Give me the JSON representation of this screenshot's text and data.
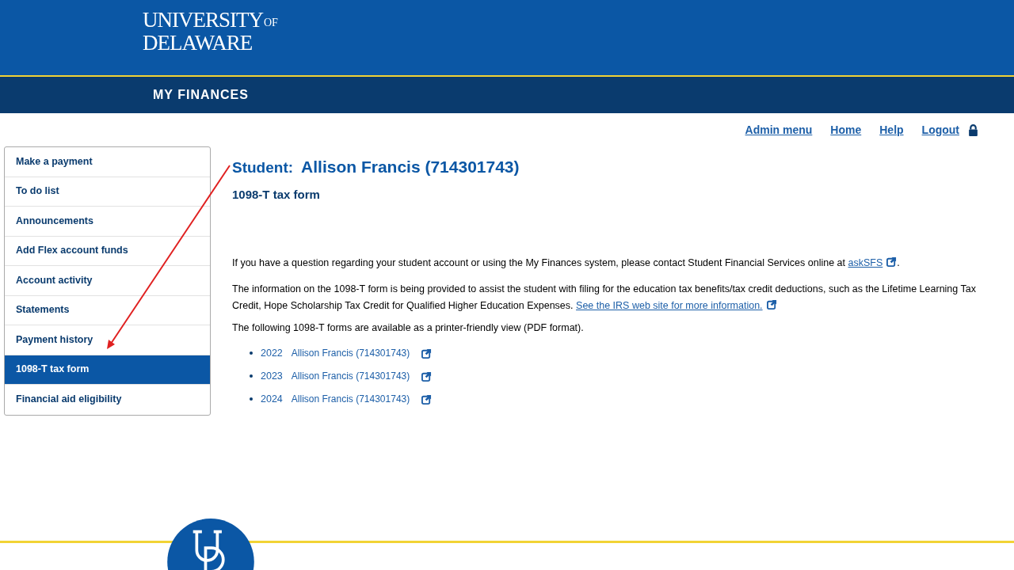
{
  "header": {
    "logo": {
      "line1": "UNIVERSITY",
      "of": "OF",
      "line2": "DELAWARE"
    },
    "section_title": "MY FINANCES"
  },
  "top_links": [
    "Admin menu",
    "Home",
    "Help",
    "Logout"
  ],
  "sidebar": {
    "items": [
      {
        "label": "Make a payment",
        "selected": false
      },
      {
        "label": "To do list",
        "selected": false
      },
      {
        "label": "Announcements",
        "selected": false
      },
      {
        "label": "Add Flex account funds",
        "selected": false
      },
      {
        "label": "Account activity",
        "selected": false
      },
      {
        "label": "Statements",
        "selected": false
      },
      {
        "label": "Payment history",
        "selected": false
      },
      {
        "label": "1098-T tax form",
        "selected": true
      },
      {
        "label": "Financial aid eligibility",
        "selected": false
      }
    ]
  },
  "content": {
    "student_label": "Student:",
    "student_name": "Allison Francis (714301743)",
    "subtitle": "1098-T tax form",
    "contact_text": "If you have a question regarding your student account or using the My Finances system, please contact Student Financial Services online at",
    "contact_link": "askSFS",
    "contact_end": ".",
    "info_text": "The information on the 1098-T form is being provided to assist the student with filing for the education tax benefits/tax credit deductions, such as the Lifetime Learning Tax Credit, Hope Scholarship Tax Credit for Qualified Higher Education Expenses.",
    "info_link": "See the IRS web site for more information.",
    "forms_intro": "The following 1098-T forms are available as a printer-friendly view (PDF format).",
    "forms": [
      {
        "year": "2022",
        "name": "Allison Francis (714301743)"
      },
      {
        "year": "2023",
        "name": "Allison Francis (714301743)"
      },
      {
        "year": "2024",
        "name": "Allison Francis (714301743)"
      }
    ]
  }
}
